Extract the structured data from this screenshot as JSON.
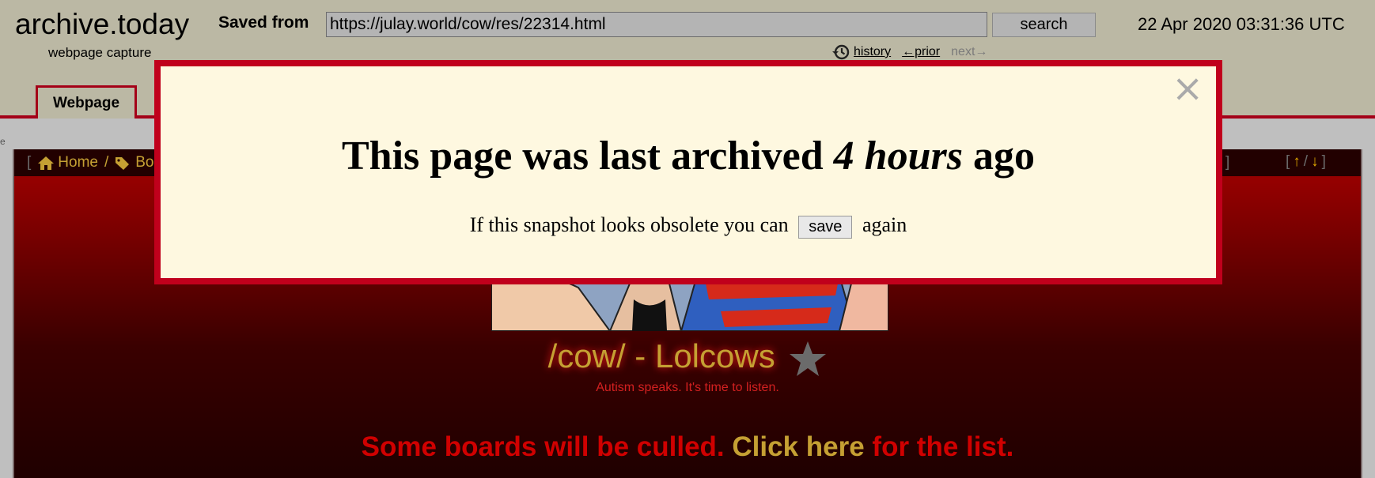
{
  "header": {
    "logo": "archive.today",
    "logo_sub": "webpage capture",
    "saved_from_label": "Saved from",
    "url": "https://julay.world/cow/res/22314.html",
    "search_label": "search",
    "timestamp": "22 Apr 2020 03:31:36 UTC",
    "history_label": "history",
    "prior_label": "←prior",
    "next_label": "next→"
  },
  "tabs": {
    "webpage_label": "Webpage"
  },
  "archived_page": {
    "topbar": {
      "open_bracket": "[",
      "home_label": "Home",
      "separator": "/",
      "boards_label": "Boa",
      "close_bracket": "]",
      "arrows_open": "[",
      "arrow_up": "↑",
      "arrows_sep": "/",
      "arrow_down": "↓",
      "arrows_close": "]"
    },
    "board_title": "/cow/ - Lolcows",
    "board_subtitle": "Autism speaks. It's time to listen.",
    "announcement_before": "Some boards will be culled. ",
    "announcement_link": "Click here",
    "announcement_after": " for the list."
  },
  "modal": {
    "heading_before": "This page was last archived ",
    "heading_emph": "4 hours",
    "heading_after": " ago",
    "msg_before": "If this snapshot looks obsolete you can",
    "save_label": "save",
    "msg_after": "again",
    "close_symbol": "×"
  },
  "colors": {
    "accent_red": "#c0001c",
    "gold": "#c5a033",
    "modal_bg": "#fef8e0"
  }
}
